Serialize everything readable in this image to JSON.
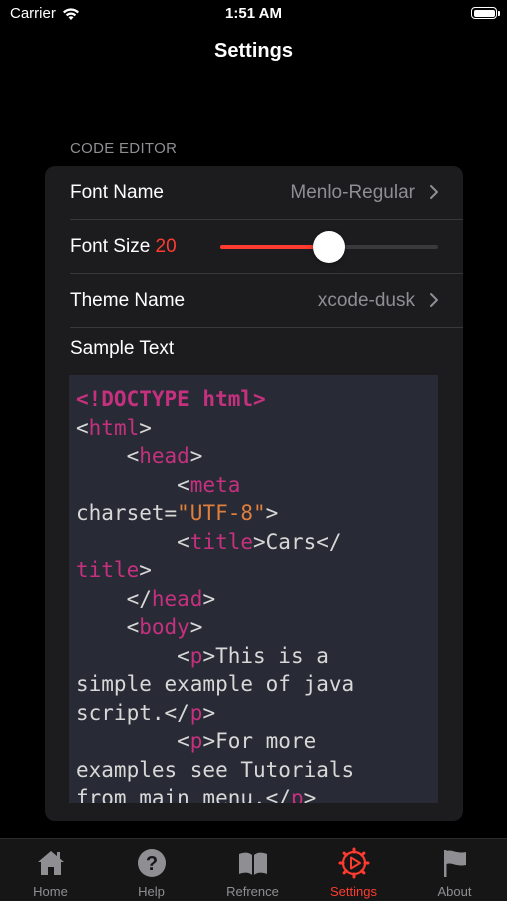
{
  "status_bar": {
    "carrier": "Carrier",
    "time": "1:51 AM"
  },
  "nav": {
    "title": "Settings"
  },
  "section": {
    "header": "CODE EDITOR"
  },
  "settings": {
    "font_name": {
      "label": "Font Name",
      "value": "Menlo-Regular"
    },
    "font_size": {
      "label": "Font Size",
      "value": "20",
      "slider_fraction": 0.5
    },
    "theme_name": {
      "label": "Theme Name",
      "value": "xcode-dusk"
    },
    "sample_text": {
      "label": "Sample Text"
    }
  },
  "code_lines": [
    [
      {
        "t": "<!DOCTYPE html>",
        "c": "kw"
      }
    ],
    [
      {
        "t": "<",
        "c": "punc"
      },
      {
        "t": "html",
        "c": "tag"
      },
      {
        "t": ">",
        "c": "punc"
      }
    ],
    [
      {
        "t": "    <",
        "c": "punc"
      },
      {
        "t": "head",
        "c": "tag"
      },
      {
        "t": ">",
        "c": "punc"
      }
    ],
    [
      {
        "t": "        <",
        "c": "punc"
      },
      {
        "t": "meta",
        "c": "tag"
      }
    ],
    [
      {
        "t": "charset=",
        "c": "attr"
      },
      {
        "t": "\"UTF-8\"",
        "c": "str"
      },
      {
        "t": ">",
        "c": "punc"
      }
    ],
    [
      {
        "t": "        <",
        "c": "punc"
      },
      {
        "t": "title",
        "c": "tag"
      },
      {
        "t": ">Cars</",
        "c": "punc"
      }
    ],
    [
      {
        "t": "title",
        "c": "tag"
      },
      {
        "t": ">",
        "c": "punc"
      }
    ],
    [
      {
        "t": "    </",
        "c": "punc"
      },
      {
        "t": "head",
        "c": "tag"
      },
      {
        "t": ">",
        "c": "punc"
      }
    ],
    [
      {
        "t": "    <",
        "c": "punc"
      },
      {
        "t": "body",
        "c": "tag"
      },
      {
        "t": ">",
        "c": "punc"
      }
    ],
    [
      {
        "t": "        <",
        "c": "punc"
      },
      {
        "t": "p",
        "c": "tag"
      },
      {
        "t": ">This is a",
        "c": "text"
      }
    ],
    [
      {
        "t": "simple example of java",
        "c": "text"
      }
    ],
    [
      {
        "t": "script.</",
        "c": "text"
      },
      {
        "t": "p",
        "c": "tag"
      },
      {
        "t": ">",
        "c": "punc"
      }
    ],
    [
      {
        "t": "        <",
        "c": "punc"
      },
      {
        "t": "p",
        "c": "tag"
      },
      {
        "t": ">For more",
        "c": "text"
      }
    ],
    [
      {
        "t": "examples see Tutorials",
        "c": "text"
      }
    ],
    [
      {
        "t": "from main menu.</",
        "c": "text"
      },
      {
        "t": "p",
        "c": "tag"
      },
      {
        "t": ">",
        "c": "punc"
      }
    ]
  ],
  "tabs": [
    {
      "label": "Home",
      "icon": "home-icon",
      "active": false
    },
    {
      "label": "Help",
      "icon": "help-icon",
      "active": false
    },
    {
      "label": "Refrence",
      "icon": "book-icon",
      "active": false
    },
    {
      "label": "Settings",
      "icon": "gear-icon",
      "active": true
    },
    {
      "label": "About",
      "icon": "flag-icon",
      "active": false
    }
  ],
  "colors": {
    "accent": "#ff3b30",
    "background": "#000000",
    "group": "#1c1c1e",
    "code_bg": "#282b35",
    "code_keyword": "#c5307f",
    "code_string": "#e07f3c"
  }
}
